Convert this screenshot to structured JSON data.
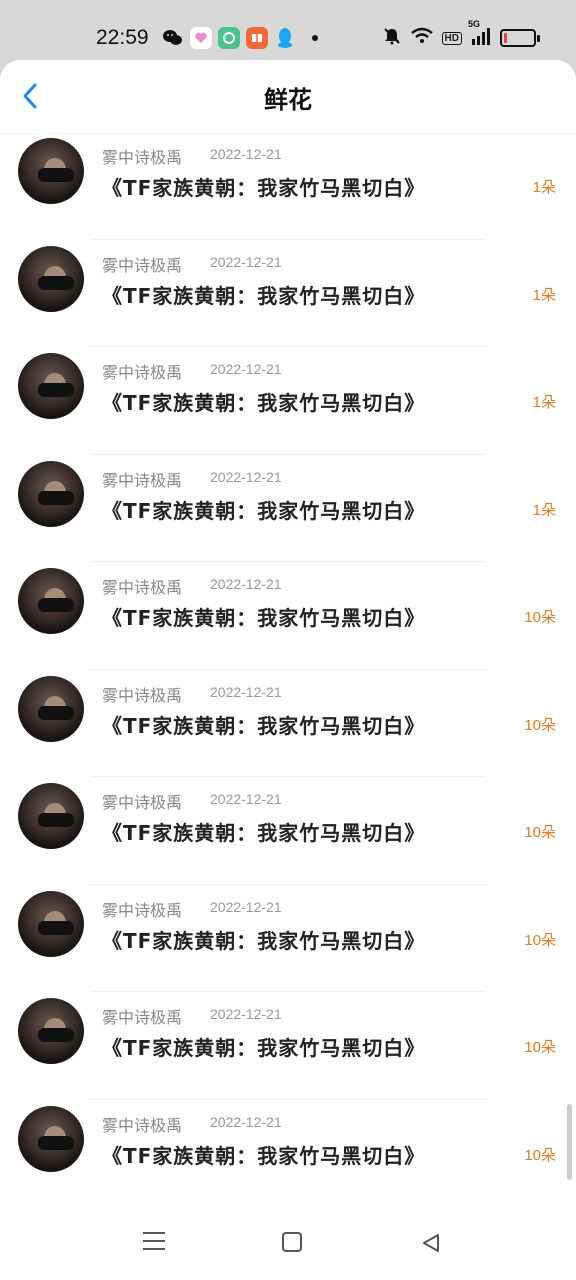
{
  "status_bar": {
    "time": "22:59",
    "app_icons": [
      "wechat-icon",
      "heart-app-icon",
      "green-app-icon",
      "orange-app-icon",
      "qq-icon"
    ],
    "hd": "HD",
    "network": "5G",
    "battery_level": 0.1,
    "battery_color": "#e2453c"
  },
  "header": {
    "title": "鲜花",
    "back_icon": "chevron-left-icon",
    "accent": "#1e88e5"
  },
  "rows": [
    {
      "author": "雾中诗极禹",
      "date": "2022-12-21",
      "book": "《TF家族黄朝：我家竹马黑切白》",
      "flowers": "1朵"
    },
    {
      "author": "雾中诗极禹",
      "date": "2022-12-21",
      "book": "《TF家族黄朝：我家竹马黑切白》",
      "flowers": "1朵"
    },
    {
      "author": "雾中诗极禹",
      "date": "2022-12-21",
      "book": "《TF家族黄朝：我家竹马黑切白》",
      "flowers": "1朵"
    },
    {
      "author": "雾中诗极禹",
      "date": "2022-12-21",
      "book": "《TF家族黄朝：我家竹马黑切白》",
      "flowers": "1朵"
    },
    {
      "author": "雾中诗极禹",
      "date": "2022-12-21",
      "book": "《TF家族黄朝：我家竹马黑切白》",
      "flowers": "10朵"
    },
    {
      "author": "雾中诗极禹",
      "date": "2022-12-21",
      "book": "《TF家族黄朝：我家竹马黑切白》",
      "flowers": "10朵"
    },
    {
      "author": "雾中诗极禹",
      "date": "2022-12-21",
      "book": "《TF家族黄朝：我家竹马黑切白》",
      "flowers": "10朵"
    },
    {
      "author": "雾中诗极禹",
      "date": "2022-12-21",
      "book": "《TF家族黄朝：我家竹马黑切白》",
      "flowers": "10朵"
    },
    {
      "author": "雾中诗极禹",
      "date": "2022-12-21",
      "book": "《TF家族黄朝：我家竹马黑切白》",
      "flowers": "10朵"
    },
    {
      "author": "雾中诗极禹",
      "date": "2022-12-21",
      "book": "《TF家族黄朝：我家竹马黑切白》",
      "flowers": "10朵"
    }
  ],
  "flower_color": "#e07a28",
  "nav_bar": {
    "icons": [
      "menu-icon",
      "home-square-icon",
      "back-triangle-icon"
    ]
  }
}
